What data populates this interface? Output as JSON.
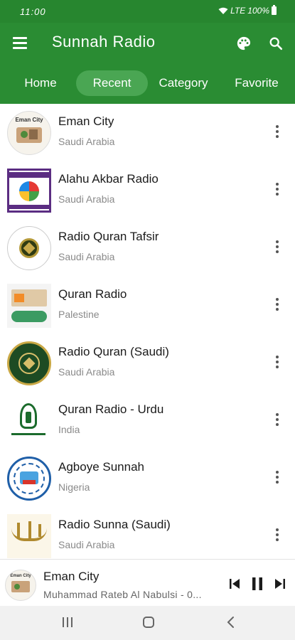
{
  "status": {
    "time": "11:00",
    "network": "LTE",
    "battery": "100%"
  },
  "appbar": {
    "title": "Sunnah Radio",
    "menu_icon": "hamburger-menu-icon",
    "palette_icon": "palette-icon",
    "search_icon": "search-icon"
  },
  "tabs": [
    {
      "label": "Home",
      "active": false
    },
    {
      "label": "Recent",
      "active": true
    },
    {
      "label": "Category",
      "active": false
    },
    {
      "label": "Favorite",
      "active": false
    }
  ],
  "stations": [
    {
      "name": "Eman City",
      "country": "Saudi Arabia",
      "logo_text": "Eman City"
    },
    {
      "name": "Alahu Akbar Radio",
      "country": "Saudi Arabia"
    },
    {
      "name": "Radio Quran Tafsir",
      "country": "Saudi Arabia"
    },
    {
      "name": "Quran Radio",
      "country": "Palestine"
    },
    {
      "name": "Radio Quran (Saudi)",
      "country": "Saudi Arabia"
    },
    {
      "name": "Quran Radio - Urdu",
      "country": "India"
    },
    {
      "name": "Agboye Sunnah",
      "country": "Nigeria"
    },
    {
      "name": "Radio Sunna (Saudi)",
      "country": "Saudi Arabia"
    }
  ],
  "player": {
    "title": "Eman City",
    "subtitle": "Muhammad Rateb Al Nabulsi - 0...",
    "logo_text": "Eman City",
    "icons": {
      "prev": "skip-previous-icon",
      "pause": "pause-icon",
      "next": "skip-next-icon"
    }
  },
  "colors": {
    "primary": "#2a8c33",
    "active_tab": "#4aa653"
  }
}
